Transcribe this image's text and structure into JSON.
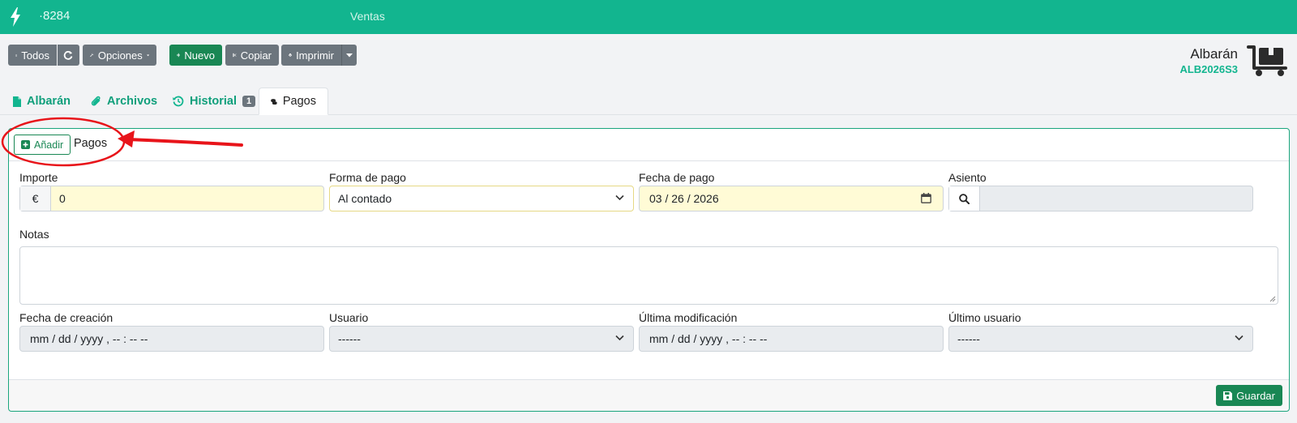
{
  "topbar": {
    "id": "·8284",
    "menu": "Ventas"
  },
  "toolbar": {
    "all_label": "Todos",
    "options_label": "Opciones",
    "new_label": "Nuevo",
    "copy_label": "Copiar",
    "print_label": "Imprimir"
  },
  "document": {
    "title": "Albarán",
    "code": "ALB2026S3"
  },
  "tabs": [
    {
      "label": "Albarán"
    },
    {
      "label": "Archivos"
    },
    {
      "label": "Historial",
      "badge": "1"
    },
    {
      "label": "Pagos"
    }
  ],
  "payments": {
    "add_label": "Añadir",
    "title": "Pagos",
    "importe": {
      "label": "Importe",
      "currency": "€",
      "value": "0"
    },
    "forma_pago": {
      "label": "Forma de pago",
      "value": "Al contado"
    },
    "fecha_pago": {
      "label": "Fecha de pago",
      "value": "03 / 26 / 2026"
    },
    "asiento": {
      "label": "Asiento",
      "value": ""
    },
    "notas": {
      "label": "Notas",
      "value": ""
    },
    "fecha_creacion": {
      "label": "Fecha de creación",
      "placeholder": "mm / dd / yyyy ,  -- : --   --"
    },
    "usuario": {
      "label": "Usuario",
      "value": "------"
    },
    "ultima_modificacion": {
      "label": "Última modificación",
      "placeholder": "mm / dd / yyyy ,  -- : --   --"
    },
    "ultimo_usuario": {
      "label": "Último usuario",
      "value": "------"
    },
    "save_label": "Guardar"
  },
  "colors": {
    "brand": "#12b58f",
    "success": "#198754",
    "secondary": "#6c757d",
    "highlight": "#fffbd6",
    "annotation": "#e8141a"
  }
}
